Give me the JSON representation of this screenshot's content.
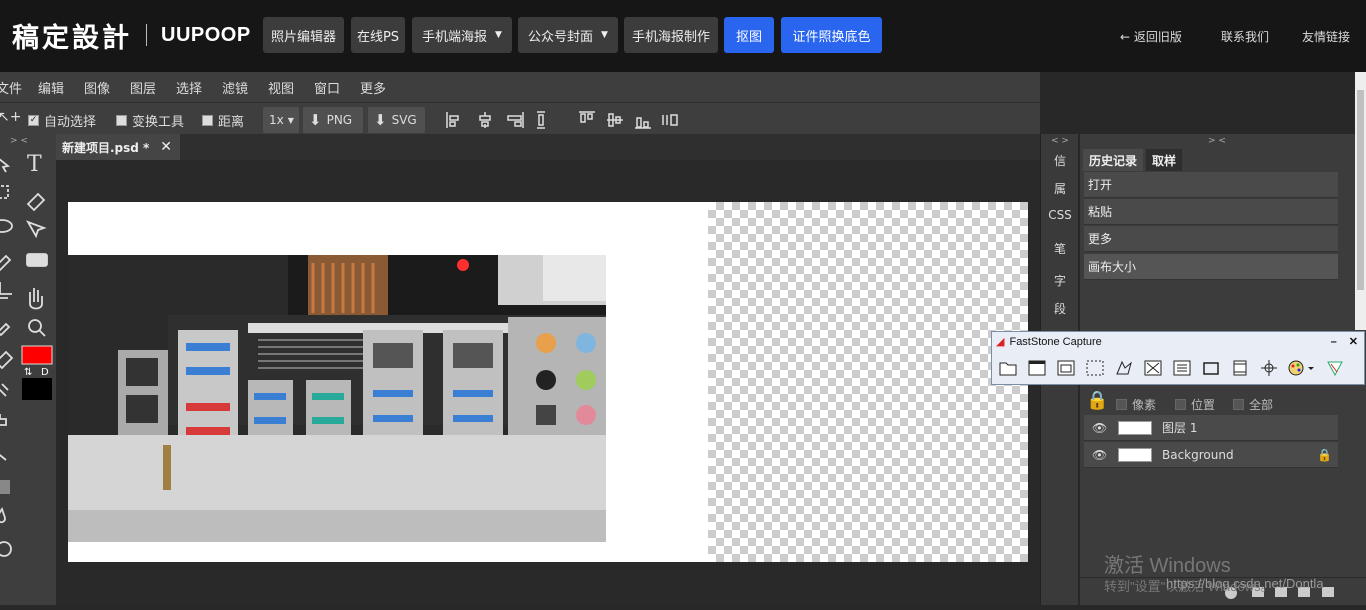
{
  "header": {
    "logo_cn": "稿定設計",
    "logo_en": "UUPOOP",
    "nav": [
      {
        "label": "照片编辑器"
      },
      {
        "label": "在线PS"
      },
      {
        "label": "手机端海报"
      },
      {
        "label": "公众号封面"
      },
      {
        "label": "手机海报制作"
      },
      {
        "label": "抠图"
      },
      {
        "label": "证件照换底色"
      }
    ],
    "links": {
      "back": "← 返回旧版",
      "contact": "联系我们",
      "friends": "友情链接"
    }
  },
  "menu": [
    "文件",
    "编辑",
    "图像",
    "图层",
    "选择",
    "滤镜",
    "视图",
    "窗口",
    "更多"
  ],
  "options": {
    "auto_select": "自动选择",
    "transform": "变换工具",
    "distance": "距离",
    "zoom": "1x",
    "png": "PNG",
    "svg": "SVG"
  },
  "document": {
    "tab": "新建项目.psd *"
  },
  "side_strip": [
    "信",
    "属",
    "CSS",
    "笔",
    "字",
    "段"
  ],
  "panel": {
    "tab_history": "历史记录",
    "tab_swatch": "取样",
    "history": [
      "打开",
      "粘贴",
      "更多",
      "画布大小"
    ],
    "lock_options": [
      "像素",
      "位置",
      "全部"
    ],
    "layers": [
      {
        "name": "图层 1"
      },
      {
        "name": "Background"
      }
    ]
  },
  "faststone": {
    "title": "FastStone Capture"
  },
  "watermark": {
    "line1": "激活 Windows",
    "line2": "转到\"设置\"以激活 Windows。",
    "url": "https://blog.csdn.net/Dontla"
  },
  "colors": {
    "fg": "#ff0000",
    "bg": "#000000",
    "accent": "#2a65f0"
  }
}
